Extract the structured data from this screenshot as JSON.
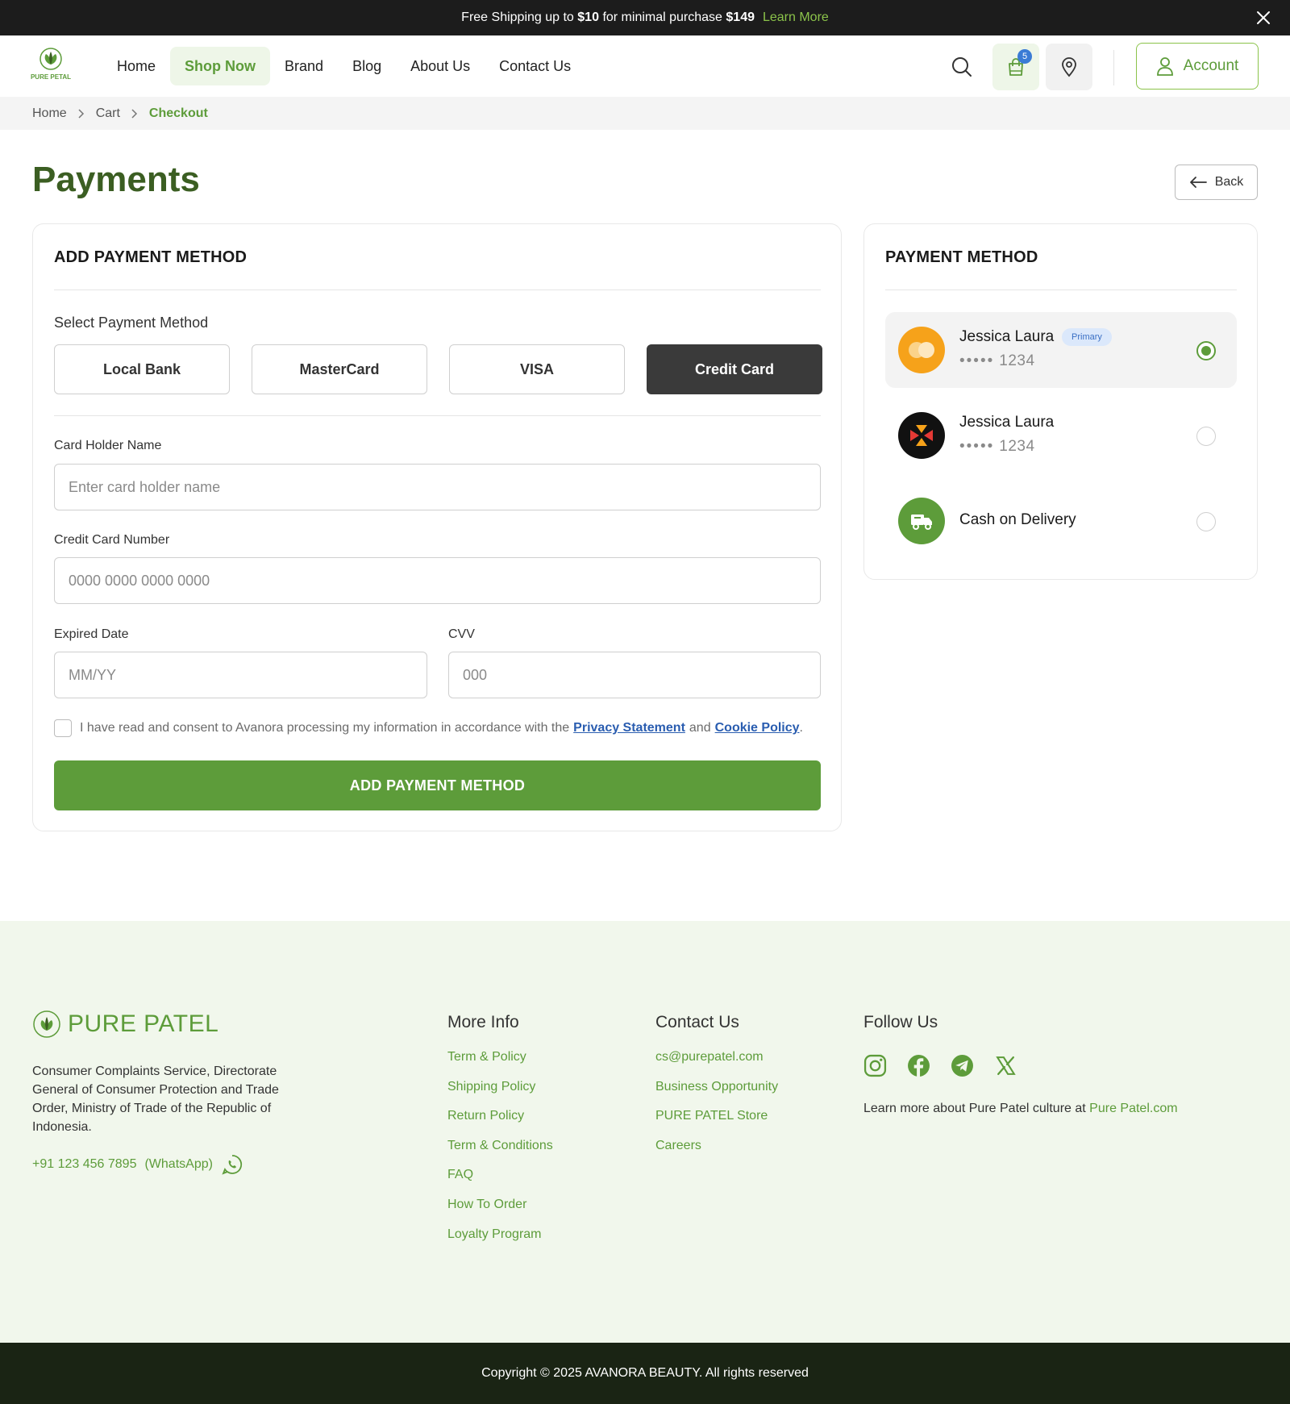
{
  "banner": {
    "text_pre": "Free Shipping up to",
    "amount1": "$10",
    "text_mid": "for minimal purchase",
    "amount2": "$149",
    "learn_more": "Learn More"
  },
  "nav": {
    "logo_text": "PURE PETAL",
    "items": [
      {
        "label": "Home"
      },
      {
        "label": "Shop Now"
      },
      {
        "label": "Brand"
      },
      {
        "label": "Blog"
      },
      {
        "label": "About Us"
      },
      {
        "label": "Contact Us"
      }
    ],
    "active_index": 1,
    "cart_count": "5",
    "account_label": "Account"
  },
  "breadcrumb": [
    "Home",
    "Cart",
    "Checkout"
  ],
  "page": {
    "title": "Payments",
    "back_label": "Back"
  },
  "add_payment": {
    "title": "ADD PAYMENT METHOD",
    "select_label": "Select Payment Method",
    "methods": [
      "Local Bank",
      "MasterCard",
      "VISA",
      "Credit Card"
    ],
    "selected_method": "Credit Card",
    "holder_label": "Card Holder Name",
    "holder_placeholder": "Enter card holder name",
    "number_label": "Credit Card Number",
    "number_placeholder": "0000 0000 0000 0000",
    "expiry_label": "Expired Date",
    "expiry_placeholder": "MM/YY",
    "cvv_label": "CVV",
    "cvv_placeholder": "000",
    "consent_text": "I have read and consent to Avanora processing my information in accordance with the",
    "privacy_link": "Privacy Statement",
    "consent_and": "and",
    "cookie_link": "Cookie Policy",
    "consent_end": ".",
    "submit_label": "ADD PAYMENT METHOD"
  },
  "payment_methods": {
    "title": "PAYMENT METHOD",
    "entries": [
      {
        "name": "Jessica Laura",
        "badge": "Primary",
        "masked": "•••••",
        "last4": "1234",
        "selected": true,
        "icon": "mastercard-icon"
      },
      {
        "name": "Jessica Laura",
        "masked": "•••••",
        "last4": "1234",
        "selected": false,
        "icon": "card-brand-icon"
      },
      {
        "name": "Cash on Delivery",
        "selected": false,
        "icon": "delivery-truck-icon"
      }
    ]
  },
  "footer": {
    "brand": "PURE PATEL",
    "address": "Consumer Complaints Service, Directorate General of Consumer Protection and Trade Order, Ministry of Trade of the Republic of Indonesia.",
    "phone": "+91 123 456 7895",
    "phone_note": "(WhatsApp)",
    "more_info": {
      "title": "More Info",
      "links": [
        "Term & Policy",
        "Shipping Policy",
        "Return Policy",
        "Term & Conditions",
        "FAQ",
        "How To Order",
        "Loyalty Program"
      ]
    },
    "contact": {
      "title": "Contact Us",
      "links": [
        "cs@purepatel.com",
        "Business Opportunity",
        "PURE PATEL Store",
        "Careers"
      ]
    },
    "follow": {
      "title": "Follow Us",
      "networks": [
        "instagram-icon",
        "facebook-icon",
        "telegram-icon",
        "x-icon"
      ],
      "culture_text": "Learn more about Pure Patel culture at",
      "culture_link": "Pure Patel.com"
    },
    "copyright": "Copyright © 2025 AVANORA BEAUTY. All rights reserved"
  },
  "colors": {
    "brand_green": "#5d9c3a",
    "dark_title": "#3b5e22",
    "footer_bg": "#f1f7ec",
    "copyright_bg": "#1a2414"
  }
}
